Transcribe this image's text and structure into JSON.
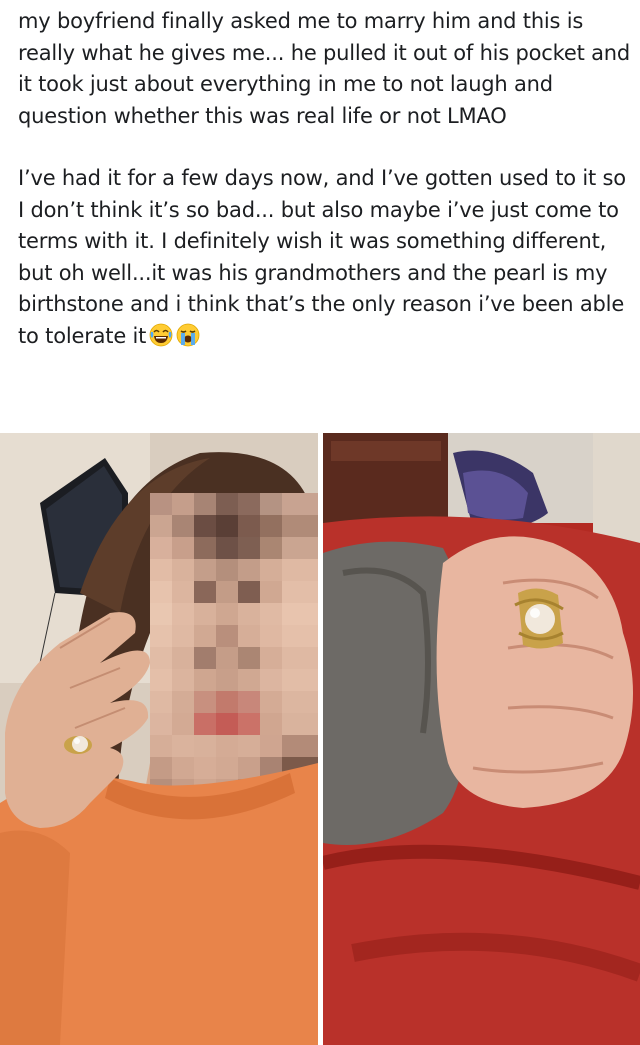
{
  "post": {
    "paragraph_1": "my boyfriend finally asked me to marry him and this is really what he gives me... he pulled it out of his pocket and it took just about everything in me to not laugh and question whether this was real life or not LMAO",
    "paragraph_2": "I’ve had it for a few days now, and I’ve gotten used to it so I don’t think it’s so bad... but also maybe i’ve just come to terms with it. I definitely wish it was something different, but oh well...it was his grandmothers and the pearl is my birthstone and i think that’s the only reason i’ve been able to tolerate it",
    "emojis": [
      "face-with-tears-of-joy-icon",
      "loudly-crying-face-icon"
    ]
  },
  "photos": {
    "left": {
      "subject": "selfie with pixelated face, orange sweater, hand with pearl ring"
    },
    "right": {
      "subject": "closed hand with gold pearl ring over red bedding"
    }
  },
  "colors": {
    "text": "#1c1e21",
    "sweater": "#e8844a",
    "bedding": "#b32a22",
    "gold": "#c9a24a",
    "pearl": "#f1e8dc"
  }
}
